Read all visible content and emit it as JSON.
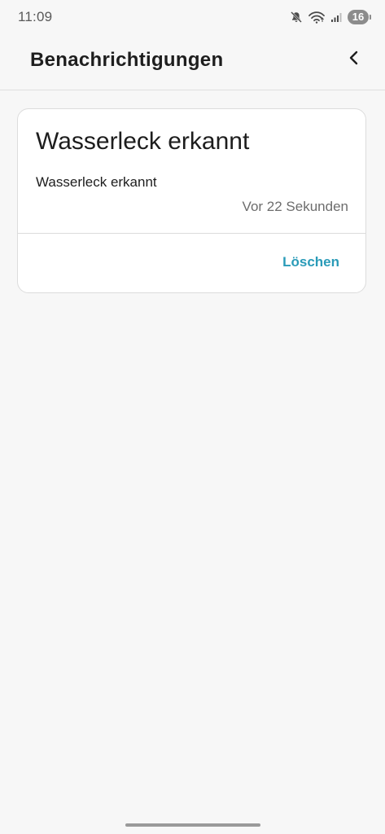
{
  "status_bar": {
    "time": "11:09",
    "icons": [
      "mute-icon",
      "wifi-icon",
      "signal-icon"
    ],
    "battery_level": "16"
  },
  "app_bar": {
    "title": "Benachrichtigungen",
    "back_icon": "chevron-left-icon"
  },
  "notification": {
    "title": "Wasserleck erkannt",
    "body": "Wasserleck erkannt",
    "time": "Vor 22 Sekunden",
    "delete_label": "Löschen"
  },
  "colors": {
    "accent": "#2a9bb8",
    "background": "#f7f7f7",
    "card": "#ffffff"
  }
}
